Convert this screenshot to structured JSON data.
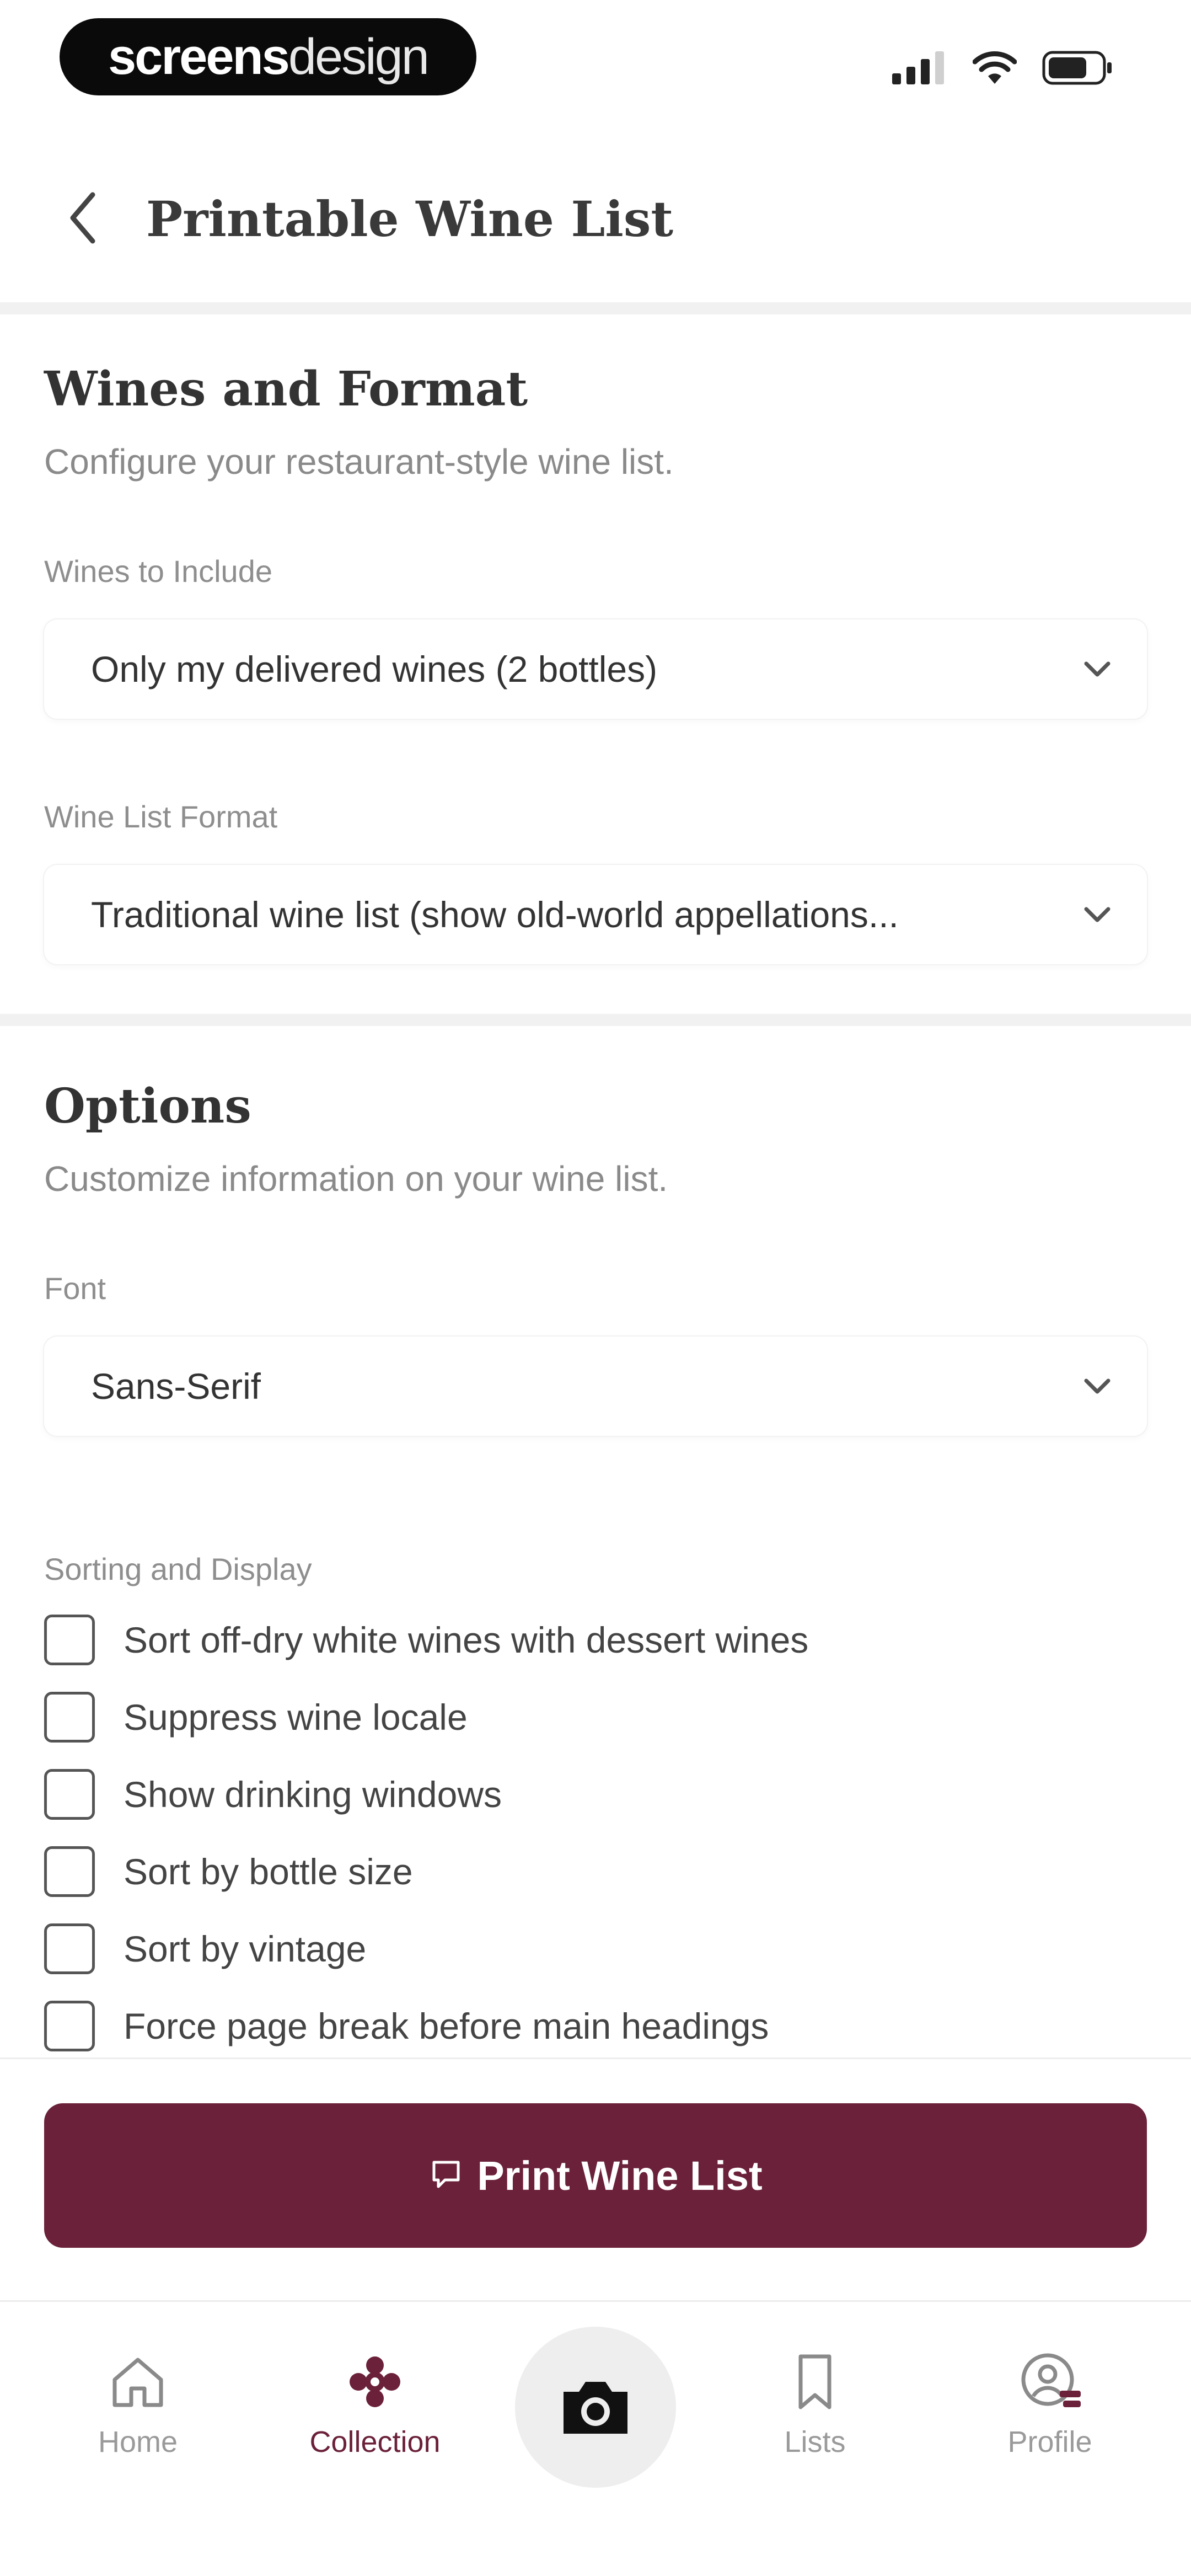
{
  "status_bar": {
    "brand_bold": "screens",
    "brand_light": "design"
  },
  "header": {
    "title": "Printable Wine List"
  },
  "wines_section": {
    "title": "Wines and Format",
    "subtitle": "Configure your restaurant-style wine list.",
    "wines_label": "Wines to Include",
    "wines_value": "Only my delivered wines (2 bottles)",
    "format_label": "Wine List Format",
    "format_value": "Traditional wine list (show old-world appellations..."
  },
  "options_section": {
    "title": "Options",
    "subtitle": "Customize information on your wine list.",
    "font_label": "Font",
    "font_value": "Sans-Serif",
    "sorting_label": "Sorting and Display",
    "checkboxes": [
      {
        "label": "Sort off-dry white wines with dessert wines",
        "checked": false
      },
      {
        "label": "Suppress wine locale",
        "checked": false
      },
      {
        "label": "Show drinking windows",
        "checked": false
      },
      {
        "label": "Sort by bottle size",
        "checked": false
      },
      {
        "label": "Sort by vintage",
        "checked": false
      },
      {
        "label": "Force page break before main headings",
        "checked": false
      }
    ]
  },
  "print": {
    "label": "Print Wine List",
    "icon": "printer-icon"
  },
  "bottom_nav": {
    "items": [
      {
        "label": "Home",
        "icon": "home-icon",
        "active": false
      },
      {
        "label": "Collection",
        "icon": "collection-icon",
        "active": true
      },
      {
        "label": "Lists",
        "icon": "bookmark-icon",
        "active": false
      },
      {
        "label": "Profile",
        "icon": "profile-icon",
        "active": false
      }
    ],
    "camera_icon": "camera-icon"
  },
  "colors": {
    "accent": "#6b2139",
    "text": "#333333",
    "muted": "#8a8a8a",
    "inactive_nav": "#9a9a9a"
  }
}
